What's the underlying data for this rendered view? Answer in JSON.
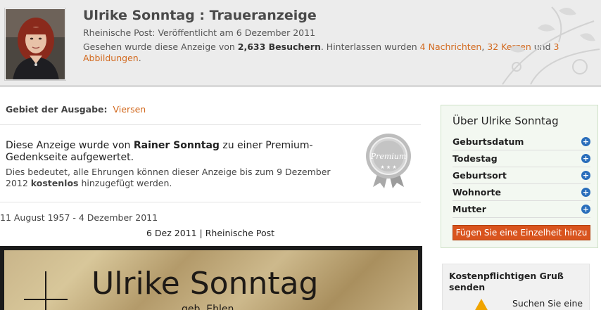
{
  "header": {
    "title": "Ulrike Sonntag : Traueranzeige",
    "publication": "Rheinische Post: Veröffentlicht am 6 Dezember 2011",
    "seen_prefix": "Gesehen wurde diese Anzeige von ",
    "visitors": "2,633 Besuchern",
    "seen_middle": ". Hinterlassen wurden ",
    "messages": "4 Nachrichten",
    "comma": ", ",
    "candles": "32 Kerzen",
    "and": " und ",
    "images": "3 Abbildungen",
    "period": "."
  },
  "region": {
    "label": "Gebiet der Ausgabe:",
    "value": "Viersen"
  },
  "premium": {
    "prefix": "Diese Anzeige wurde von ",
    "person": "Rainer Sonntag",
    "suffix": " zu einer Premium-Gedenkseite aufgewertet.",
    "sub_prefix": "Dies bedeutet, alle Ehrungen können dieser Anzeige bis zum 9 Dezember 2012 ",
    "sub_bold": "kostenlos",
    "sub_suffix": " hinzugefügt werden.",
    "seal_text": "Premium"
  },
  "life_dates": "11 August 1957 - 4 Dezember 2011",
  "date_line": "6 Dez 2011 | Rheinische Post",
  "notice": {
    "name": "Ulrike Sonntag",
    "maiden": "geb. Ehlen"
  },
  "about": {
    "title": "Über Ulrike Sonntag",
    "rows": [
      {
        "label": "Geburtsdatum"
      },
      {
        "label": "Todestag"
      },
      {
        "label": "Geburtsort"
      },
      {
        "label": "Wohnorte"
      },
      {
        "label": "Mutter"
      }
    ],
    "add_button": "Fügen Sie eine Einzelheit hinzu"
  },
  "greeting": {
    "title": "Kostenpflichtigen Gruß senden",
    "text": "Suchen Sie eine"
  },
  "colors": {
    "accent_link": "#d2691e",
    "button": "#d9541e",
    "plus_icon": "#2a6ebb"
  }
}
